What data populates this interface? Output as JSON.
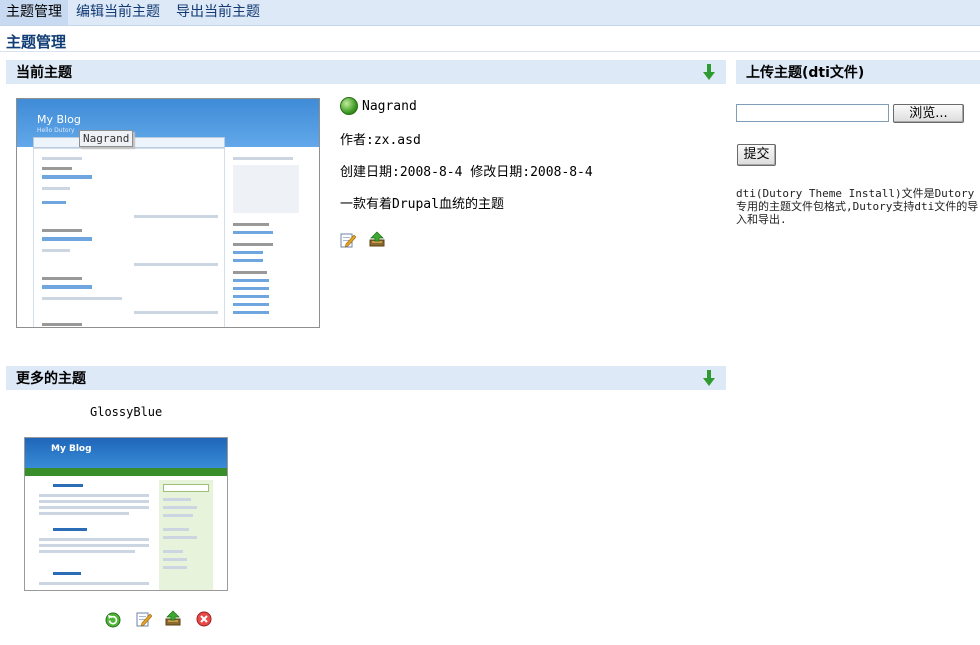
{
  "nav": {
    "tabs": [
      {
        "label": "主题管理",
        "active": true
      },
      {
        "label": "编辑当前主题",
        "active": false
      },
      {
        "label": "导出当前主题",
        "active": false
      }
    ]
  },
  "page": {
    "title": "主题管理"
  },
  "current": {
    "section_label": "当前主题",
    "tooltip": "Nagrand",
    "preview": {
      "blog_title": "My Blog",
      "blog_subtitle": "Hello Dutory"
    },
    "theme": {
      "name": "Nagrand",
      "author": "作者:zx.asd",
      "dates": "创建日期:2008-8-4  修改日期:2008-8-4",
      "description": "一款有着Drupal血统的主题"
    },
    "actions": [
      "edit-icon",
      "export-icon"
    ]
  },
  "upload": {
    "section_label": "上传主题(dti文件)",
    "browse_label": "浏览...",
    "submit_label": "提交",
    "description": "dti(Dutory Theme Install)文件是Dutory专用的主题文件包格式,Dutory支持dti文件的导入和导出."
  },
  "more": {
    "section_label": "更多的主题",
    "themes": [
      {
        "name": "GlossyBlue",
        "preview": {
          "blog_title": "My Blog"
        },
        "actions": [
          "apply-icon",
          "edit-icon",
          "export-icon",
          "delete-icon"
        ]
      }
    ]
  },
  "colors": {
    "accent": "#103d74",
    "bar": "#dde9f7",
    "arrow": "#2f9a2f"
  }
}
